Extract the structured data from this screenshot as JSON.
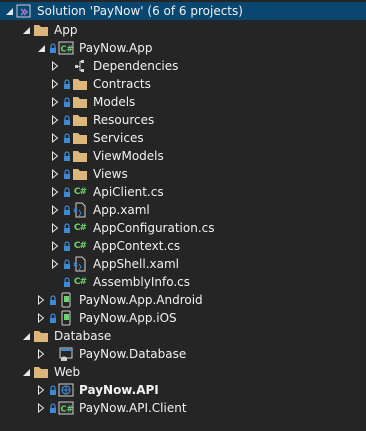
{
  "solution": {
    "label": "Solution 'PayNow' (6 of 6 projects)"
  },
  "app_folder": {
    "label": "App"
  },
  "paynow_app": {
    "label": "PayNow.App",
    "children": {
      "dependencies": "Dependencies",
      "contracts": "Contracts",
      "models": "Models",
      "resources": "Resources",
      "services": "Services",
      "viewmodels": "ViewModels",
      "views": "Views",
      "apiclient": "ApiClient.cs",
      "app_xaml": "App.xaml",
      "appconfiguration": "AppConfiguration.cs",
      "appcontext": "AppContext.cs",
      "appshell": "AppShell.xaml",
      "assemblyinfo": "AssemblyInfo.cs"
    }
  },
  "paynow_android": {
    "label": "PayNow.App.Android"
  },
  "paynow_ios": {
    "label": "PayNow.App.iOS"
  },
  "database_folder": {
    "label": "Database"
  },
  "paynow_database": {
    "label": "PayNow.Database"
  },
  "web_folder": {
    "label": "Web"
  },
  "paynow_api": {
    "label": "PayNow.API"
  },
  "paynow_api_client": {
    "label": "PayNow.API.Client"
  },
  "icons": {
    "csharp_file_glyph": "C#"
  },
  "colors": {
    "background": "#252526",
    "selection": "#094771",
    "folder": "#dcb67a",
    "lock": "#3c8ad8",
    "csharp": "#6fd26f",
    "text": "#f1f1f1"
  }
}
